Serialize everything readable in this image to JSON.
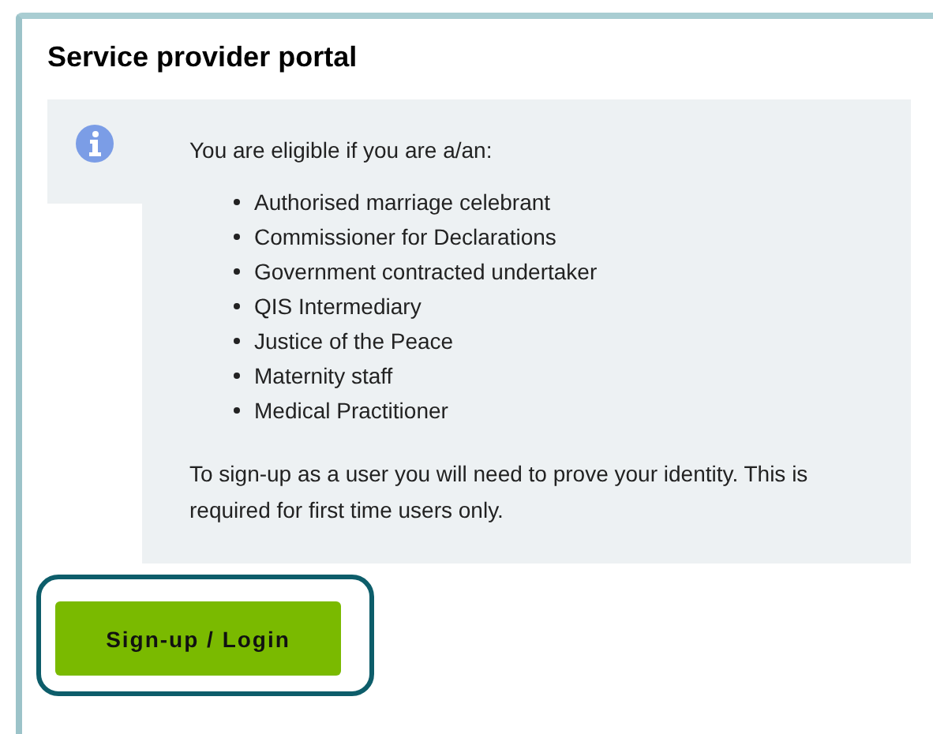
{
  "title": "Service provider portal",
  "notice": {
    "intro": "You are eligible if you are a/an:",
    "items": [
      "Authorised marriage celebrant",
      "Commissioner for Declarations",
      "Government contracted undertaker",
      "QIS Intermediary",
      "Justice of the Peace",
      "Maternity staff",
      "Medical Practitioner"
    ],
    "note": "To sign-up as a user you will need to prove your identity. This is required for first time users only."
  },
  "button": "Sign-up / Login"
}
